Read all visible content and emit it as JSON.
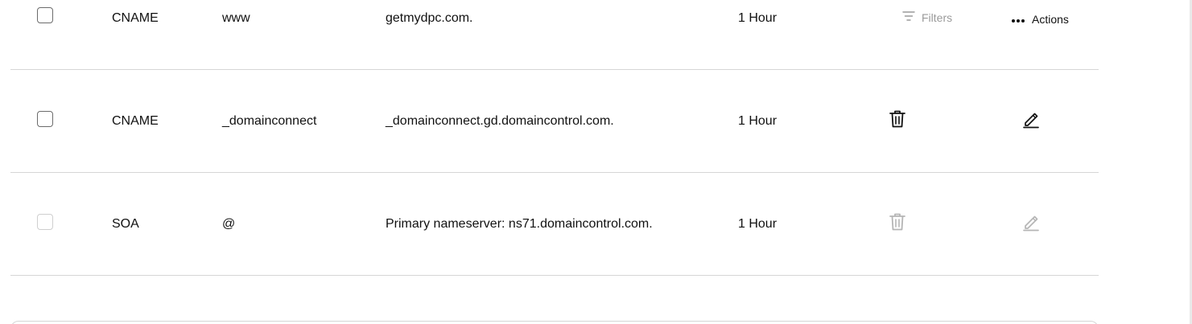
{
  "toolbar": {
    "filters_label": "Filters",
    "actions_label": "Actions"
  },
  "records": [
    {
      "type": "CNAME",
      "name": "www",
      "value": "getmydpc.com.",
      "ttl": "1 Hour",
      "editable": true
    },
    {
      "type": "CNAME",
      "name": "_domainconnect",
      "value": "_domainconnect.gd.domaincontrol.com.",
      "ttl": "1 Hour",
      "editable": true
    },
    {
      "type": "SOA",
      "name": "@",
      "value": "Primary nameserver: ns71.domaincontrol.com.",
      "ttl": "1 Hour",
      "editable": false
    }
  ],
  "icons": {
    "filter": "filter-icon",
    "more": "more-horizontal-icon",
    "delete": "trash-icon",
    "edit": "pencil-icon"
  },
  "colors": {
    "text": "#111111",
    "muted": "#9a9a9a",
    "divider": "#d6d6d6",
    "disabled_icon": "#b5b5b5"
  }
}
